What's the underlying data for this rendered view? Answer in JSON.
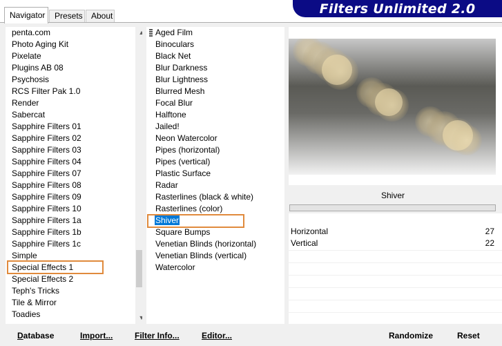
{
  "tabs": [
    "Navigator",
    "Presets",
    "About"
  ],
  "banner": "Filters Unlimited 2.0",
  "categories": [
    "penta.com",
    "Photo Aging Kit",
    "Pixelate",
    "Plugins AB 08",
    "Psychosis",
    "RCS Filter Pak 1.0",
    "Render",
    "Sabercat",
    "Sapphire Filters 01",
    "Sapphire Filters 02",
    "Sapphire Filters 03",
    "Sapphire Filters 04",
    "Sapphire Filters 07",
    "Sapphire Filters 08",
    "Sapphire Filters 09",
    "Sapphire Filters 10",
    "Sapphire Filters 1a",
    "Sapphire Filters 1b",
    "Sapphire Filters 1c",
    "Simple",
    "Special Effects 1",
    "Special Effects 2",
    "Teph's Tricks",
    "Tile & Mirror",
    "Toadies"
  ],
  "selected_category": "Special Effects 1",
  "filters": [
    "Aged Film",
    "Binoculars",
    "Black Net",
    "Blur Darkness",
    "Blur Lightness",
    "Blurred Mesh",
    "Focal Blur",
    "Halftone",
    "Jailed!",
    "Neon Watercolor",
    "Pipes (horizontal)",
    "Pipes (vertical)",
    "Plastic Surface",
    "Radar",
    "Rasterlines (black & white)",
    "Rasterlines (color)",
    "Shiver",
    "Square Bumps",
    "Venetian Blinds (horizontal)",
    "Venetian Blinds (vertical)",
    "Watercolor"
  ],
  "selected_filter": "Shiver",
  "current_filter_title": "Shiver",
  "params": [
    {
      "label": "Horizontal",
      "value": "27"
    },
    {
      "label": "Vertical",
      "value": "22"
    }
  ],
  "buttons": {
    "database": {
      "first": "D",
      "rest": "atabase"
    },
    "import": {
      "first": "Import...",
      "rest": ""
    },
    "filter_info": {
      "first": "Filter Info...",
      "rest": ""
    },
    "editor": {
      "first": "Editor...",
      "rest": ""
    },
    "randomize": "Randomize",
    "reset": "Reset"
  },
  "colors": {
    "selection_outline": "#e08a3c",
    "selection_highlight": "#0078d7",
    "banner": "#0b0b85"
  },
  "icons": {
    "scroll_up": "chevron-up-icon",
    "scroll_down": "chevron-down-icon",
    "drag_grip": "drag-grip-icon"
  }
}
